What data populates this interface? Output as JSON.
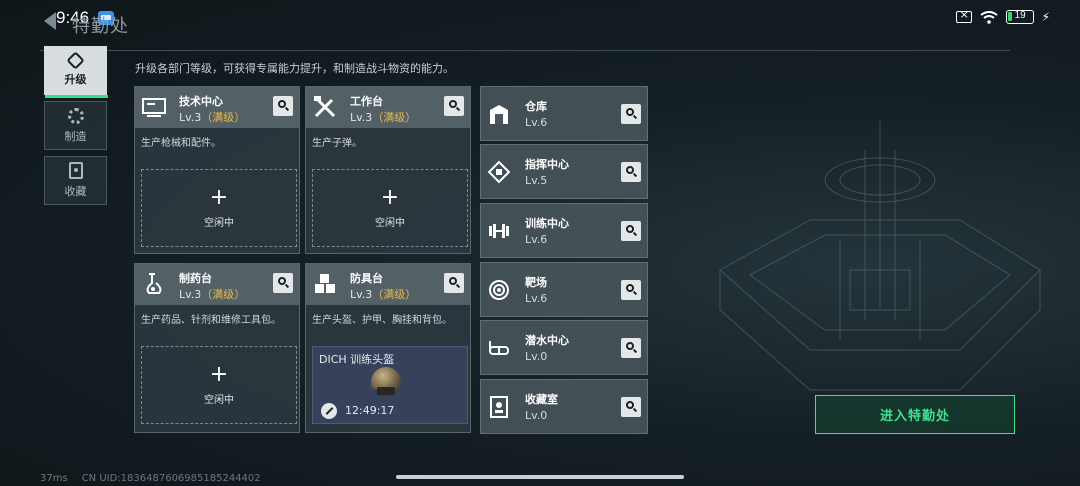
{
  "status": {
    "time": "9:46",
    "battery": "19",
    "battery_level": 0.19
  },
  "header": {
    "title": "特勤处",
    "subtitle": "升级各部门等级，可获得专属能力提升，和制造战斗物资的能力。"
  },
  "tabs": [
    {
      "label": "升级",
      "icon": "upgrade-icon",
      "active": true
    },
    {
      "label": "制造",
      "icon": "gear-icon",
      "active": false
    },
    {
      "label": "收藏",
      "icon": "collection-icon",
      "active": false
    }
  ],
  "stations": [
    {
      "name": "技术中心",
      "level": "Lv.3",
      "max": "（满级）",
      "desc": "生产枪械和配件。",
      "slot": "空闲中",
      "icon": "tech-center-icon"
    },
    {
      "name": "工作台",
      "level": "Lv.3",
      "max": "（满级）",
      "desc": "生产子弹。",
      "slot": "空闲中",
      "icon": "workbench-icon"
    },
    {
      "name": "制药台",
      "level": "Lv.3",
      "max": "（满级）",
      "desc": "生产药品、针剂和维修工具包。",
      "slot": "空闲中",
      "icon": "pharmacy-icon"
    },
    {
      "name": "防具台",
      "level": "Lv.3",
      "max": "（满级）",
      "desc": "生产头盔、护甲、胸挂和背包。",
      "craft_item": "DICH 训练头盔",
      "craft_time": "12:49:17",
      "icon": "armor-bench-icon"
    }
  ],
  "facilities": [
    {
      "name": "仓库",
      "level": "Lv.6",
      "icon": "warehouse-icon"
    },
    {
      "name": "指挥中心",
      "level": "Lv.5",
      "icon": "command-center-icon"
    },
    {
      "name": "训练中心",
      "level": "Lv.6",
      "icon": "dumbbell-icon"
    },
    {
      "name": "靶场",
      "level": "Lv.6",
      "icon": "target-icon"
    },
    {
      "name": "潜水中心",
      "level": "Lv.0",
      "icon": "diving-goggles-icon"
    },
    {
      "name": "收藏室",
      "level": "Lv.0",
      "icon": "collection-room-icon"
    }
  ],
  "enter_button": "进入特勤处",
  "footer": {
    "ping": "37ms",
    "uid": "CN UID:1836487606985185244402"
  }
}
